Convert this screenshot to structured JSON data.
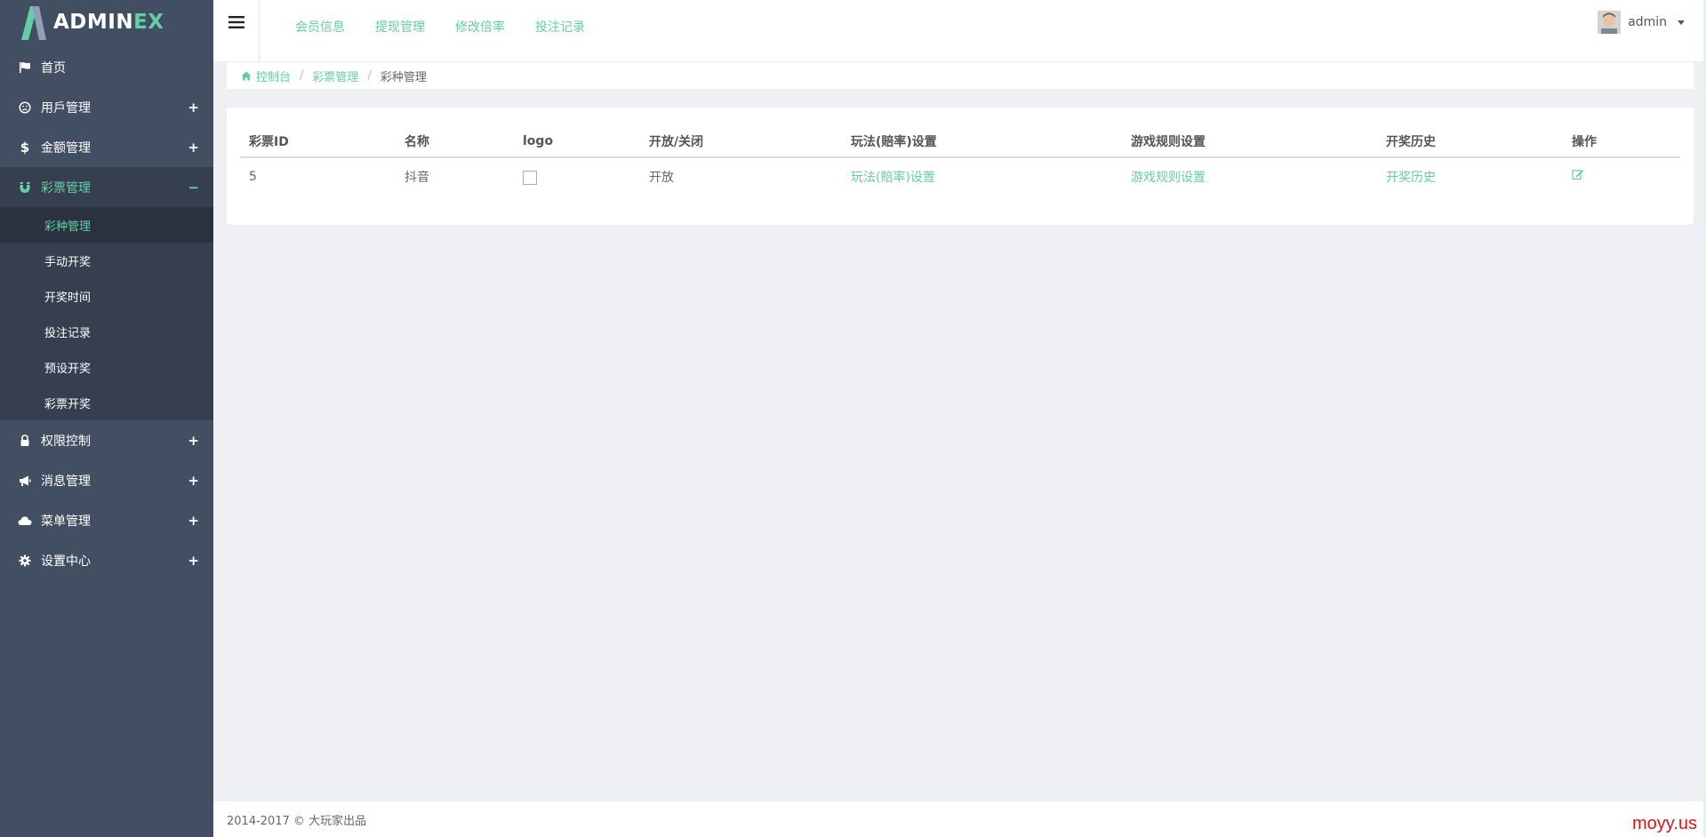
{
  "brand": {
    "main": "ADMIN",
    "accent": "EX"
  },
  "sidebar": {
    "items": [
      {
        "label": "首页",
        "icon": "flag-icon",
        "toggle": ""
      },
      {
        "label": "用戶管理",
        "icon": "smile-icon",
        "toggle": "+"
      },
      {
        "label": "金额管理",
        "icon": "dollar-icon",
        "toggle": "+"
      },
      {
        "label": "彩票管理",
        "icon": "magnet-icon",
        "toggle": "−"
      },
      {
        "label": "权限控制",
        "icon": "lock-icon",
        "toggle": "+"
      },
      {
        "label": "消息管理",
        "icon": "bullhorn-icon",
        "toggle": "+"
      },
      {
        "label": "菜单管理",
        "icon": "cloud-icon",
        "toggle": "+"
      },
      {
        "label": "设置中心",
        "icon": "gear-icon",
        "toggle": "+"
      }
    ],
    "subitems": [
      "彩种管理",
      "手动开奖",
      "开奖时间",
      "投注记录",
      "预设开奖",
      "彩票开奖"
    ]
  },
  "header": {
    "links": [
      "会员信息",
      "提现管理",
      "修改倍率",
      "投注记录"
    ],
    "user": "admin"
  },
  "breadcrumb": {
    "home": "控制台",
    "section": "彩票管理",
    "current": "彩种管理"
  },
  "table": {
    "headers": [
      "彩票ID",
      "名称",
      "logo",
      "开放/关闭",
      "玩法(賠率)设置",
      "游戏规则设置",
      "开奖历史",
      "操作"
    ],
    "rows": [
      {
        "id": "5",
        "name": "抖音",
        "status": "开放",
        "play": "玩法(賠率)设置",
        "rules": "游戏规则设置",
        "history": "开奖历史"
      }
    ]
  },
  "footer": {
    "text": "2014-2017 © 大玩家出品"
  },
  "watermark": "moyy.us",
  "colors": {
    "accent": "#65cea7",
    "sidebar": "#424f63",
    "sidebar_active": "#353f4f"
  }
}
